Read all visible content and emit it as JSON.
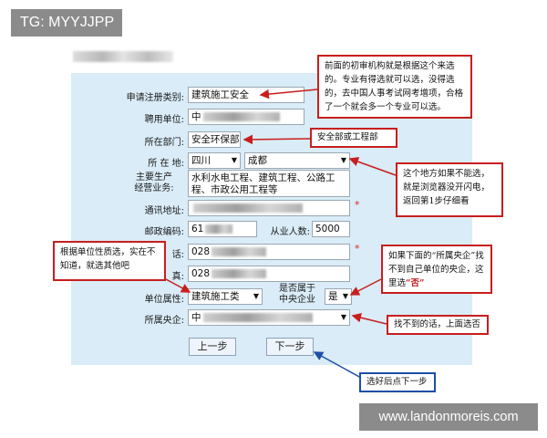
{
  "tag": "TG: MYYJJPP",
  "watermark": "www.landonmoreis.com",
  "form": {
    "reg_category": {
      "label": "申请注册类别:",
      "value": "建筑施工安全"
    },
    "employer": {
      "label": "聘用单位:",
      "value": "中"
    },
    "department": {
      "label": "所在部门:",
      "value": "安全环保部"
    },
    "location": {
      "label": "所 在 地:",
      "province": "四川",
      "city": "成都"
    },
    "business_scope": {
      "label_line1": "主要生产",
      "label_line2": "经营业务:",
      "value": "水利水电工程、建筑工程、公路工程、市政公用工程等"
    },
    "address": {
      "label": "通讯地址:",
      "value": ""
    },
    "postcode": {
      "label": "邮政编码:",
      "value": "61"
    },
    "staff_count": {
      "label": "从业人数:",
      "value": "5000"
    },
    "phone": {
      "label": "话:",
      "value": "028"
    },
    "fax": {
      "label": "真:",
      "value": "028"
    },
    "unit_nature": {
      "label": "单位属性:",
      "value": "建筑施工类"
    },
    "is_central": {
      "label_line1": "是否属于",
      "label_line2": "中央企业",
      "value": "是"
    },
    "central_enterprise": {
      "label": "所属央企:",
      "value": "中"
    },
    "required_mark": "*",
    "prev_button": "上一步",
    "next_button": "下一步"
  },
  "notes": {
    "top": "前面的初审机构就是根据这个来选的。专业有得选就可以选，没得选的，去中国人事考试网考增项，合格了一个就会多一个专业可以选。",
    "department": "安全部或工程部",
    "location": "这个地方如果不能选，就是浏览器没开闪电，返回第1步仔细看",
    "unit_nature": "根据单位性质选，实在不知道，就选其他吧",
    "central_prefix": "如果下面的“所属央企”找不到自己单位的央企，这里选",
    "central_em": "“否”",
    "not_found": "找不到的话，上面选否",
    "next": "选好后点下一步"
  },
  "colors": {
    "panel": "#d9ecf7",
    "note_border": "#c81e1e",
    "blue_note_border": "#1d4fa8"
  }
}
